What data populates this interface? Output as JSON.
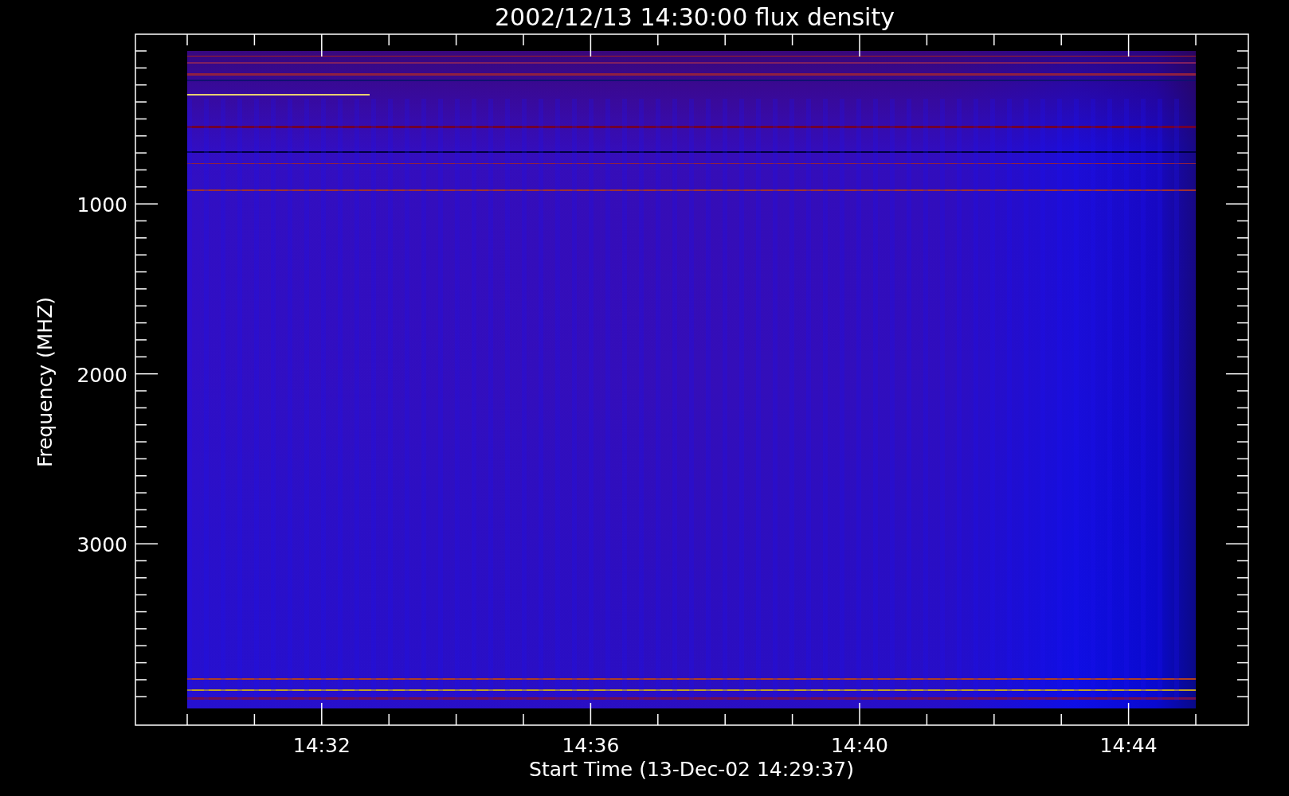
{
  "title": "2002/12/13 14:30:00 flux density",
  "plot": {
    "y_axis_title": "Frequency (MHZ)",
    "x_axis_title": "Start Time (13-Dec-02 14:29:37)",
    "y_tick_labels": [
      "1000",
      "2000",
      "3000"
    ],
    "x_tick_labels": [
      "14:32",
      "14:36",
      "14:40",
      "14:44"
    ]
  }
}
